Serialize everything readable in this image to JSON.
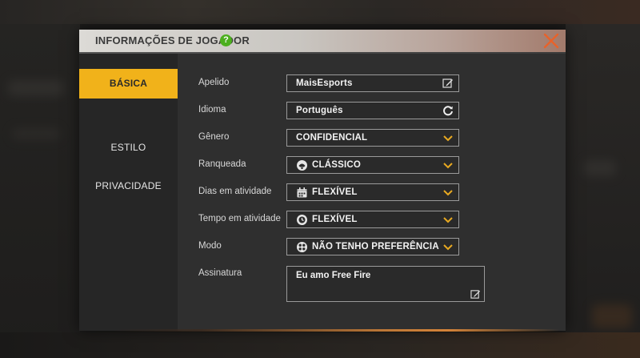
{
  "dialog": {
    "title": "INFORMAÇÕES DE JOGADOR",
    "help_symbol": "?",
    "close_icon": "close-icon"
  },
  "sidebar": {
    "items": [
      {
        "label": "BÁSICA",
        "active": true
      },
      {
        "label": "ESTILO",
        "active": false
      },
      {
        "label": "PRIVACIDADE",
        "active": false
      }
    ]
  },
  "form": {
    "nickname": {
      "label": "Apelido",
      "value": "MaisEsports",
      "icon": "edit-icon"
    },
    "language": {
      "label": "Idioma",
      "value": "Português",
      "icon": "refresh-icon"
    },
    "gender": {
      "label": "Gênero",
      "value": "CONFIDENCIAL",
      "icon": "chevron-down-icon"
    },
    "ranked": {
      "label": "Ranqueada",
      "value": "CLÁSSICO",
      "icon": "classic-mode-icon"
    },
    "active_days": {
      "label": "Dias em atividade",
      "value": "FLEXÍVEL",
      "icon": "calendar-icon"
    },
    "active_time": {
      "label": "Tempo em atividade",
      "value": "FLEXÍVEL",
      "icon": "clock-icon"
    },
    "mode": {
      "label": "Modo",
      "value": "NÃO TENHO PREFERÊNCIA",
      "icon": "squad-icon"
    },
    "signature": {
      "label": "Assinatura",
      "value": "Eu amo Free Fire",
      "icon": "edit-icon"
    }
  },
  "colors": {
    "accent": "#f1b21a",
    "help": "#4caf1e",
    "close": "#e8622a",
    "chevron": "#e8a921"
  }
}
